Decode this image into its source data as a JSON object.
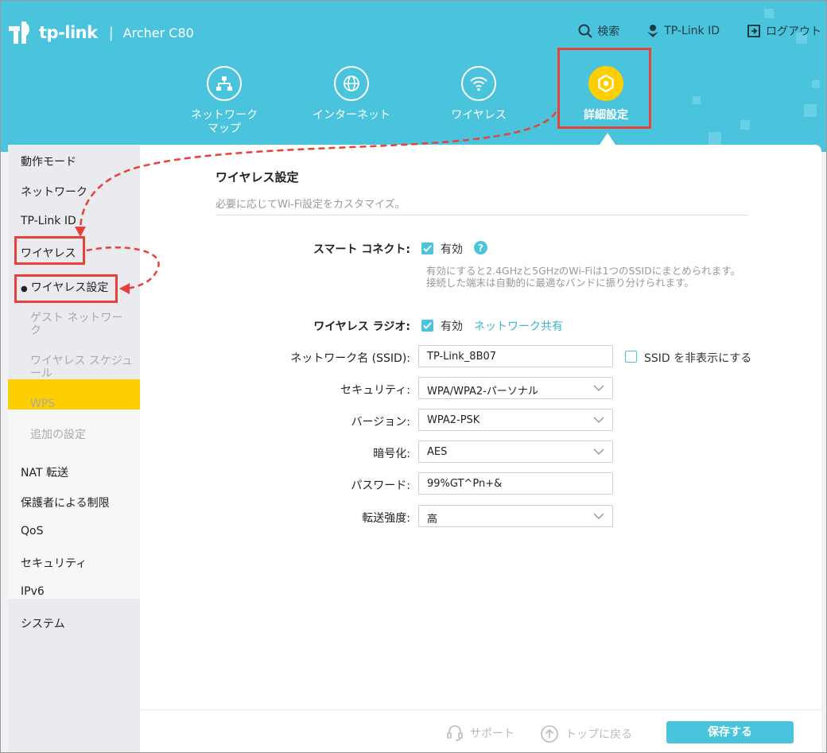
{
  "header": {
    "brand": "tp-link",
    "separator": "|",
    "model": "Archer C80",
    "links": {
      "search": "検索",
      "tplink_id": "TP-Link ID",
      "logout": "ログアウト"
    },
    "tabs": [
      {
        "label": "ネットワーク\nマップ",
        "icon": "network-map-icon"
      },
      {
        "label": "インターネット",
        "icon": "globe-icon"
      },
      {
        "label": "ワイヤレス",
        "icon": "wifi-icon"
      },
      {
        "label": "詳細設定",
        "icon": "gear-icon",
        "active": true
      }
    ]
  },
  "sidebar": {
    "items": [
      {
        "label": "動作モード"
      },
      {
        "label": "ネットワーク"
      },
      {
        "label": "TP-Link ID"
      },
      {
        "label": "ワイヤレス",
        "active": true
      },
      {
        "label": "NAT 転送"
      },
      {
        "label": "保護者による制限"
      },
      {
        "label": "QoS"
      },
      {
        "label": "セキュリティ"
      },
      {
        "label": "IPv6"
      },
      {
        "label": "システム"
      }
    ],
    "subitems": [
      {
        "label": "ワイヤレス設定",
        "active": true
      },
      {
        "label": "ゲスト ネットワーク"
      },
      {
        "label": "ワイヤレス スケジュール"
      },
      {
        "label": "WPS"
      },
      {
        "label": "追加の設定"
      }
    ]
  },
  "main": {
    "title": "ワイヤレス設定",
    "subtitle": "必要に応じてWi-Fi設定をカスタマイズ。",
    "smart_connect": {
      "label": "スマート コネクト:",
      "checkbox_label": "有効",
      "description": "有効にすると2.4GHzと5GHzのWi-Fiは1つのSSIDにまとめられます。接続した端末は自動的に最適なバンドに振り分けられます。"
    },
    "radio": {
      "label": "ワイヤレス ラジオ:",
      "checkbox_label": "有効",
      "link": "ネットワーク共有"
    },
    "ssid": {
      "label": "ネットワーク名 (SSID):",
      "value": "TP-Link_8B07",
      "hide_label": "SSID を非表示にする"
    },
    "security": {
      "label": "セキュリティ:",
      "value": "WPA/WPA2-パーソナル"
    },
    "version": {
      "label": "バージョン:",
      "value": "WPA2-PSK"
    },
    "encryption": {
      "label": "暗号化:",
      "value": "AES"
    },
    "password": {
      "label": "パスワード:",
      "value": "99%GT^Pn+&"
    },
    "tx_power": {
      "label": "転送強度:",
      "value": "高"
    }
  },
  "footer": {
    "support": "サポート",
    "back_to_top": "トップに戻る",
    "save": "保存する"
  },
  "colors": {
    "header": "#4ac4dc",
    "accent": "#4ac4dc",
    "active": "#fecf00",
    "annotation": "#e8403a"
  }
}
